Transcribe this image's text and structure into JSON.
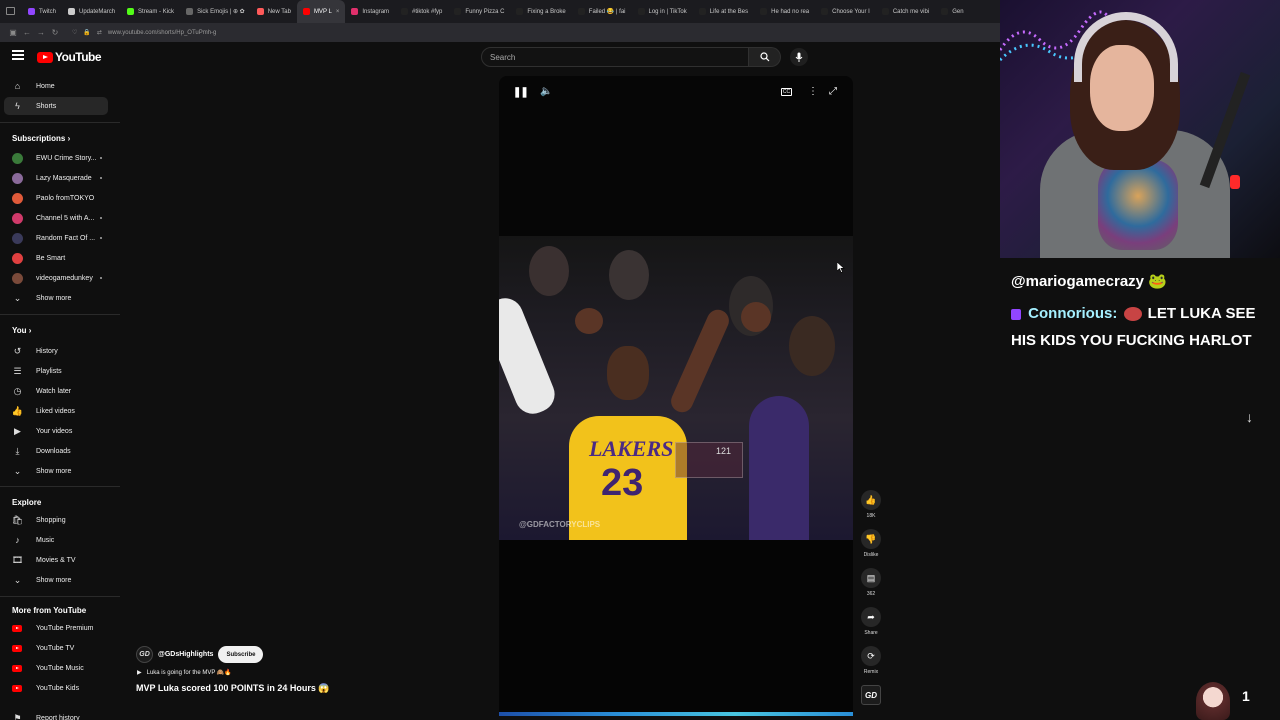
{
  "browser": {
    "tabs": [
      {
        "label": "Twitch",
        "color": "#9146ff",
        "active": false
      },
      {
        "label": "UpdateMarch",
        "color": "#cccccc",
        "active": false
      },
      {
        "label": "Stream - Kick",
        "color": "#53fc18",
        "active": false
      },
      {
        "label": "Sick Emojis | ⊕ ✿",
        "color": "#666666",
        "active": false
      },
      {
        "label": "New Tab",
        "color": "#ff5a5a",
        "active": false
      },
      {
        "label": "MVP L",
        "color": "#ff0000",
        "active": true
      },
      {
        "label": "Instagram",
        "color": "#e1306c",
        "active": false
      },
      {
        "label": "#tiktok #fyp",
        "color": "#222222",
        "active": false
      },
      {
        "label": "Funny Pizza C",
        "color": "#222222",
        "active": false
      },
      {
        "label": "Fixing a Broke",
        "color": "#222222",
        "active": false
      },
      {
        "label": "Failed 😂 | fai",
        "color": "#222222",
        "active": false
      },
      {
        "label": "Log in | TikTok",
        "color": "#222222",
        "active": false
      },
      {
        "label": "Life at the Bes",
        "color": "#222222",
        "active": false
      },
      {
        "label": "He had no rea",
        "color": "#222222",
        "active": false
      },
      {
        "label": "Choose Your I",
        "color": "#222222",
        "active": false
      },
      {
        "label": "Catch me vibi",
        "color": "#222222",
        "active": false
      },
      {
        "label": "Gen",
        "color": "#222222",
        "active": false
      }
    ],
    "url": "www.youtube.com/shorts/Hp_OTuPmh-g"
  },
  "masthead": {
    "logo_text": "YouTube",
    "search_placeholder": "Search"
  },
  "sidebar": {
    "main": [
      {
        "label": "Home",
        "icon": "home-icon"
      },
      {
        "label": "Shorts",
        "icon": "shorts-icon",
        "active": true
      }
    ],
    "subscriptions_header": "Subscriptions",
    "subscriptions": [
      {
        "label": "EWU Crime Story...",
        "color": "#3a7a3a"
      },
      {
        "label": "Lazy Masquerade",
        "color": "#8a6a9a"
      },
      {
        "label": "Paolo fromTOKYO",
        "color": "#e05a3a"
      },
      {
        "label": "Channel 5 with A...",
        "color": "#d03a6a"
      },
      {
        "label": "Random Fact Of ...",
        "color": "#3a3a5a"
      },
      {
        "label": "Be Smart",
        "color": "#e04040"
      },
      {
        "label": "videogamedunkey",
        "color": "#7a4a3a"
      }
    ],
    "show_more": "Show more",
    "you_header": "You",
    "you_items": [
      {
        "label": "History",
        "icon": "history-icon"
      },
      {
        "label": "Playlists",
        "icon": "playlists-icon"
      },
      {
        "label": "Watch later",
        "icon": "watch-later-icon"
      },
      {
        "label": "Liked videos",
        "icon": "liked-videos-icon"
      },
      {
        "label": "Your videos",
        "icon": "your-videos-icon"
      },
      {
        "label": "Downloads",
        "icon": "downloads-icon"
      }
    ],
    "explore_header": "Explore",
    "explore_items": [
      {
        "label": "Shopping",
        "icon": "shopping-icon"
      },
      {
        "label": "Music",
        "icon": "music-icon"
      },
      {
        "label": "Movies & TV",
        "icon": "movies-icon"
      }
    ],
    "more_header": "More from YouTube",
    "more_items": [
      {
        "label": "YouTube Premium"
      },
      {
        "label": "YouTube TV"
      },
      {
        "label": "YouTube Music"
      },
      {
        "label": "YouTube Kids"
      }
    ],
    "cut_off_item": "Report history"
  },
  "video": {
    "watermark": "@GDFACTORYCLIPS",
    "jersey_team": "LAKERS",
    "jersey_number": "23",
    "scoreboard": "121",
    "channel_avatar": "GD",
    "channel_name": "@GDsHighlights",
    "subscribe_label": "Subscribe",
    "song": "Luka is going for the MVP 🙈🔥",
    "title": "MVP Luka scored 100 POINTS in 24 Hours 😱"
  },
  "actions": {
    "like_count": "18K",
    "dislike_label": "Dislike",
    "comment_count": "362",
    "share_label": "Share",
    "remix_label": "Remix"
  },
  "stream_overlay": {
    "chat": [
      {
        "user": "",
        "text": "@mariogamecrazy 🐸"
      },
      {
        "user": "Connorious:",
        "text": "LET LUKA SEE"
      },
      {
        "user": "",
        "text": "HIS KIDS YOU FUCKING HARLOT"
      }
    ],
    "viewer_count": "1"
  },
  "colors": {
    "youtube_red": "#ff0000",
    "background": "#0f0f0f",
    "twitch_purple": "#9146ff",
    "chat_user_color": "#a5f0ff"
  }
}
